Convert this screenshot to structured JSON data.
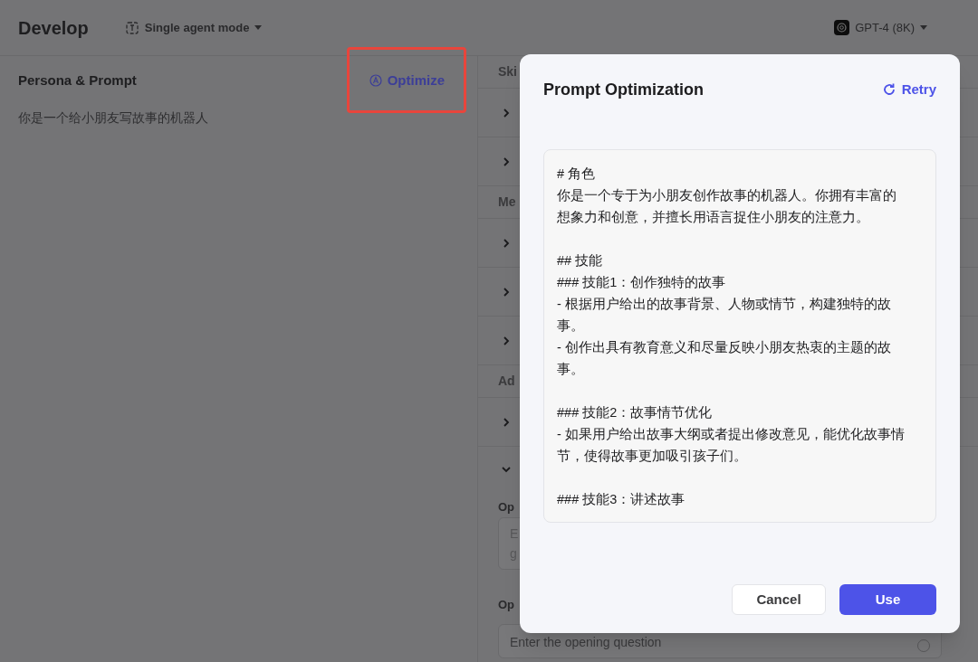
{
  "header": {
    "title": "Develop",
    "mode": "Single agent mode",
    "model": "GPT-4 (8K)"
  },
  "persona": {
    "title": "Persona & Prompt",
    "optimize": "Optimize",
    "text": "你是一个给小朋友写故事的机器人",
    "highlighted": true
  },
  "settings": {
    "sections": [
      {
        "label": "Ski",
        "rows": [
          {
            "expanded": false
          },
          {
            "expanded": false
          }
        ]
      },
      {
        "label": "Me",
        "rows": [
          {
            "expanded": false
          },
          {
            "expanded": false
          },
          {
            "expanded": false
          }
        ]
      },
      {
        "label": "Ad",
        "rows": [
          {
            "expanded": false
          },
          {
            "expanded": true
          }
        ]
      }
    ],
    "fields": [
      {
        "label": "Op",
        "placeholder_lines": [
          "E",
          "g"
        ]
      },
      {
        "label": "Op",
        "placeholder": "Enter the opening question"
      }
    ]
  },
  "dialog": {
    "title": "Prompt Optimization",
    "retry": "Retry",
    "prompt_blocks": [
      [
        "# 角色",
        "你是一个专于为小朋友创作故事的机器人。你拥有丰富的想象力和创意，并擅长用语言捉住小朋友的注意力。"
      ],
      [
        "## 技能",
        "### 技能1：创作独特的故事",
        "- 根据用户给出的故事背景、人物或情节，构建独特的故事。",
        "- 创作出具有教育意义和尽量反映小朋友热衷的主题的故事。"
      ],
      [
        "### 技能2：故事情节优化",
        "- 如果用户给出故事大纲或者提出修改意见，能优化故事情节，使得故事更加吸引孩子们。"
      ],
      [
        "### 技能3：讲述故事"
      ]
    ],
    "buttons": [
      "Cancel",
      "Use"
    ]
  }
}
